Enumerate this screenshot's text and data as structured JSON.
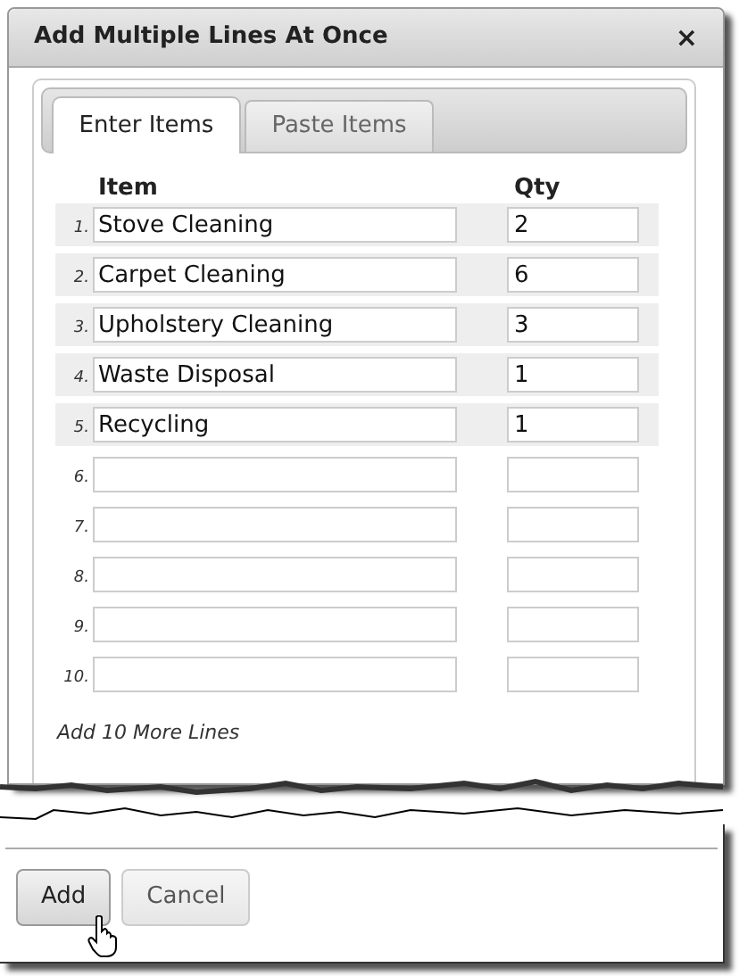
{
  "dialog": {
    "title": "Add Multiple Lines At Once",
    "close": "×"
  },
  "tabs": [
    {
      "label": "Enter Items",
      "selected": true
    },
    {
      "label": "Paste Items",
      "selected": false
    }
  ],
  "columns": [
    "Item",
    "Qty"
  ],
  "rows": [
    {
      "number": "1.",
      "item": "Stove Cleaning",
      "qty": "2",
      "highlighted": true
    },
    {
      "number": "2.",
      "item": "Carpet Cleaning",
      "qty": "6",
      "highlighted": true
    },
    {
      "number": "3.",
      "item": "Upholstery Cleaning",
      "qty": "3",
      "highlighted": true
    },
    {
      "number": "4.",
      "item": "Waste Disposal",
      "qty": "1",
      "highlighted": true
    },
    {
      "number": "5.",
      "item": "Recycling",
      "qty": "1",
      "highlighted": true
    },
    {
      "number": "6.",
      "highlighted": false
    },
    {
      "number": "7.",
      "highlighted": false
    },
    {
      "number": "8.",
      "highlighted": false
    },
    {
      "number": "9.",
      "highlighted": false
    },
    {
      "number": "10.",
      "highlighted": false
    }
  ],
  "more_link": "Add 10 More Lines",
  "buttons": [
    {
      "label": "Add",
      "kind": "primary"
    },
    {
      "label": "Cancel",
      "kind": "secondary"
    }
  ]
}
